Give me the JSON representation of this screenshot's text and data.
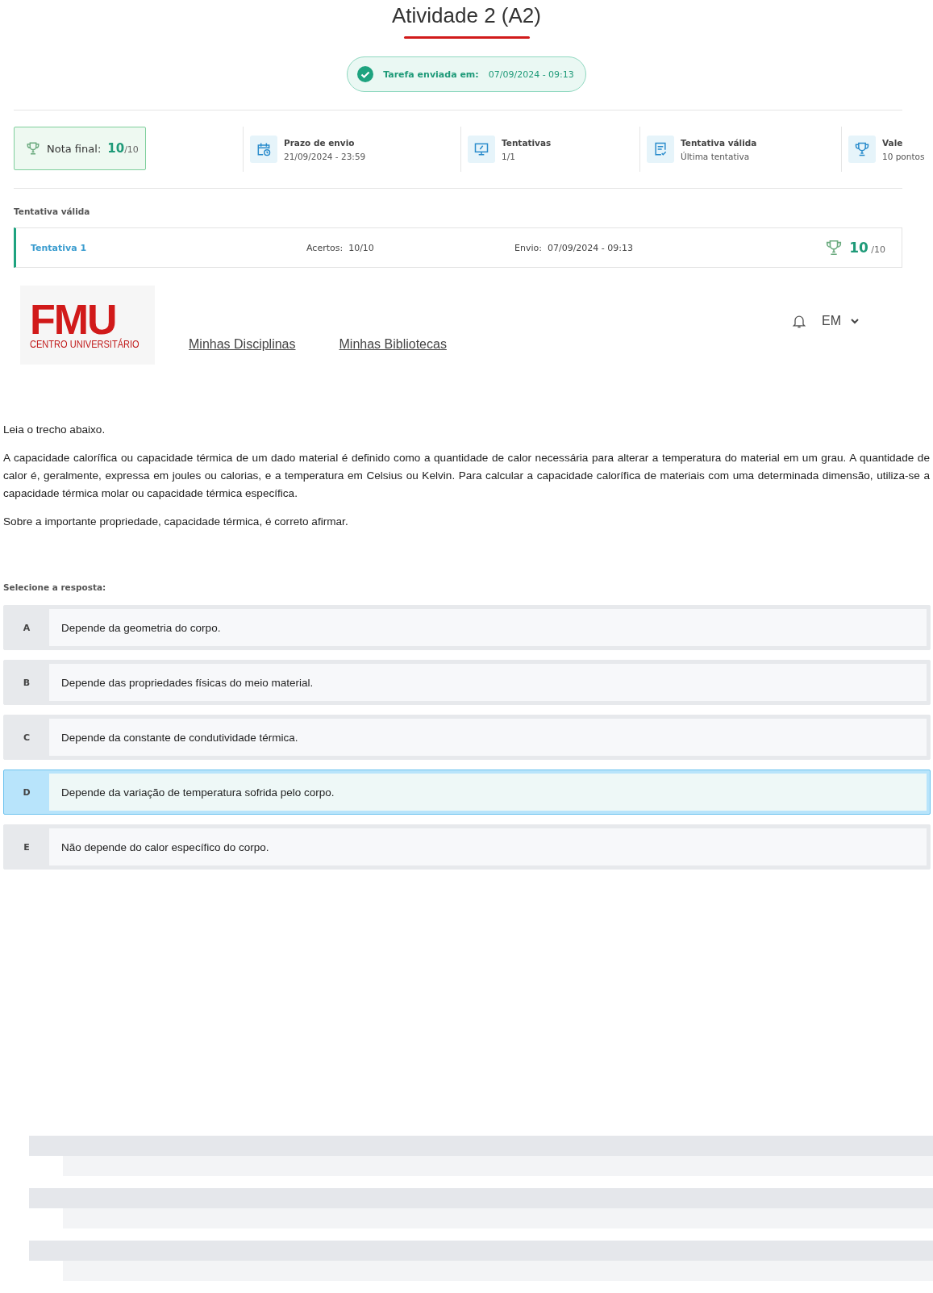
{
  "title": "Atividade 2 (A2)",
  "submitted": {
    "label": "Tarefa enviada em:",
    "value": "07/09/2024 - 09:13"
  },
  "final_grade": {
    "label": "Nota final:",
    "score": "10",
    "total": "/10"
  },
  "stats": [
    {
      "kind": "calendar",
      "label": "Prazo de envio",
      "value": "21/09/2024 - 23:59"
    },
    {
      "kind": "monitor",
      "label": "Tentativas",
      "value": "1/1"
    },
    {
      "kind": "document",
      "label": "Tentativa válida",
      "value": "Última tentativa"
    },
    {
      "kind": "trophy",
      "label": "Vale",
      "value": "10 pontos"
    }
  ],
  "attempts": {
    "heading": "Tentativa válida",
    "rows": [
      {
        "name": "Tentativa 1",
        "hits_label": "Acertos:",
        "hits": "10/10",
        "sent_label": "Envio:",
        "sent": "07/09/2024 - 09:13",
        "score": "10",
        "total": "/10"
      }
    ]
  },
  "nav": {
    "logo": {
      "mark": "FMU",
      "sub": "CENTRO UNIVERSITÁRIO"
    },
    "links": [
      "Minhas Disciplinas",
      "Minhas Bibliotecas"
    ],
    "user": "EM"
  },
  "question": {
    "paragraphs": [
      "Leia o trecho abaixo.",
      "A capacidade calorífica ou capacidade térmica de um dado material é definido como a quantidade de calor necessária para alterar a temperatura do material em um grau. A quantidade de calor é, geralmente, expressa em joules ou calorias, e a temperatura em Celsius ou Kelvin. Para calcular a capacidade calorífica de materiais com uma determinada dimensão, utiliza-se a capacidade térmica molar ou capacidade térmica específica.",
      "Sobre a importante propriedade, capacidade térmica, é correto afirmar."
    ],
    "prompt": "Selecione a resposta:",
    "options": [
      {
        "letter": "A",
        "text": "Depende da geometria do corpo.",
        "selected": false
      },
      {
        "letter": "B",
        "text": "Depende das propriedades físicas do meio material.",
        "selected": false
      },
      {
        "letter": "C",
        "text": "Depende da constante de condutividade térmica.",
        "selected": false
      },
      {
        "letter": "D",
        "text": "Depende da variação de temperatura sofrida pelo corpo.",
        "selected": true
      },
      {
        "letter": "E",
        "text": "Não depende do calor específico do corpo.",
        "selected": false
      }
    ]
  }
}
